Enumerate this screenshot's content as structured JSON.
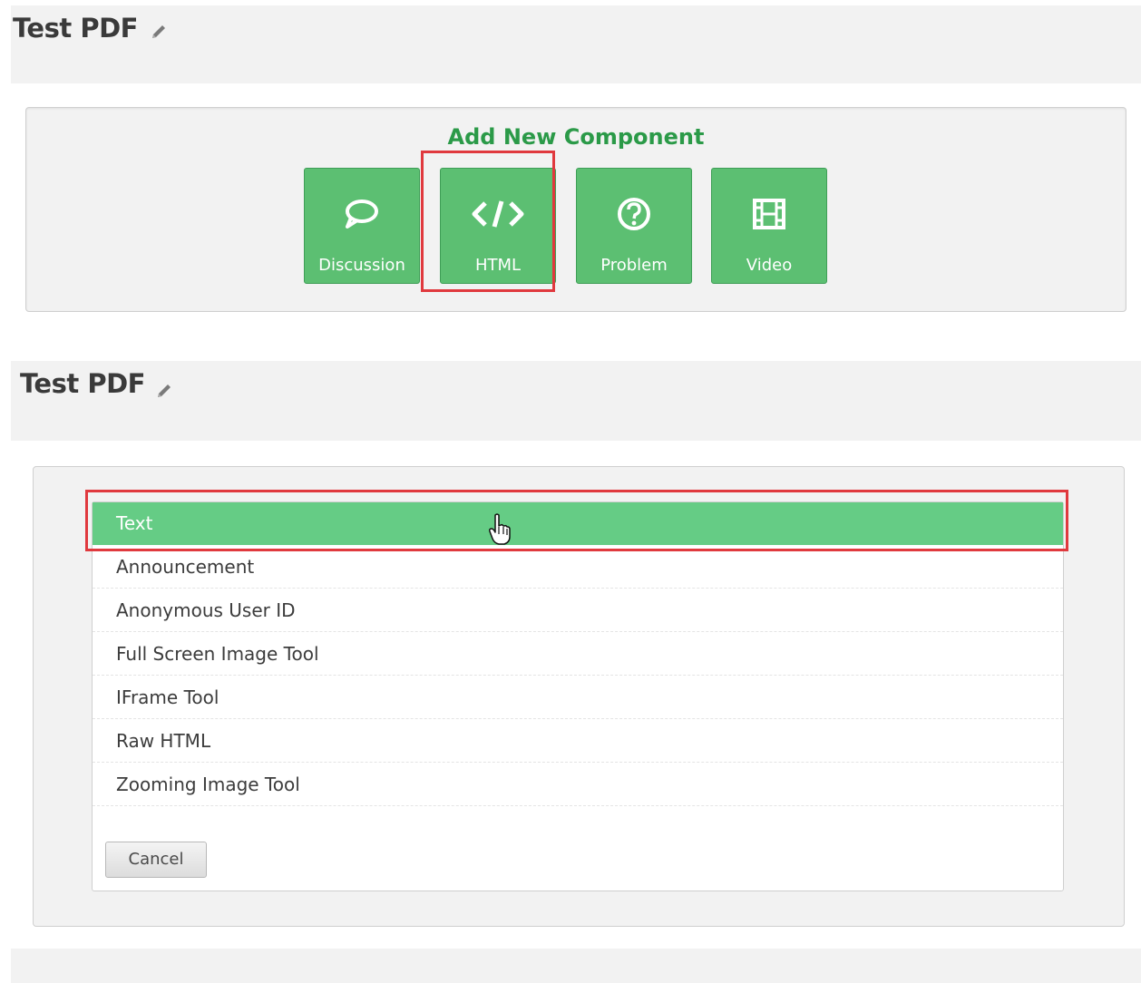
{
  "top": {
    "unit_title": "Test PDF",
    "add_component_title": "Add New Component",
    "components": [
      {
        "label": "Discussion",
        "icon": "speech-bubble-icon"
      },
      {
        "label": "HTML",
        "icon": "code-icon"
      },
      {
        "label": "Problem",
        "icon": "question-circle-icon"
      },
      {
        "label": "Video",
        "icon": "film-icon"
      }
    ]
  },
  "bottom": {
    "unit_title": "Test PDF",
    "menu": {
      "items": [
        {
          "label": "Text",
          "active": true
        },
        {
          "label": "Announcement"
        },
        {
          "label": "Anonymous User ID"
        },
        {
          "label": "Full Screen Image Tool"
        },
        {
          "label": "IFrame Tool"
        },
        {
          "label": "Raw HTML"
        },
        {
          "label": "Zooming Image Tool"
        }
      ]
    },
    "cancel_label": "Cancel"
  },
  "colors": {
    "accent_green": "#5cbf72",
    "active_item": "#65cc85",
    "title_green": "#2b9a48",
    "highlight_red": "#e0393e"
  }
}
